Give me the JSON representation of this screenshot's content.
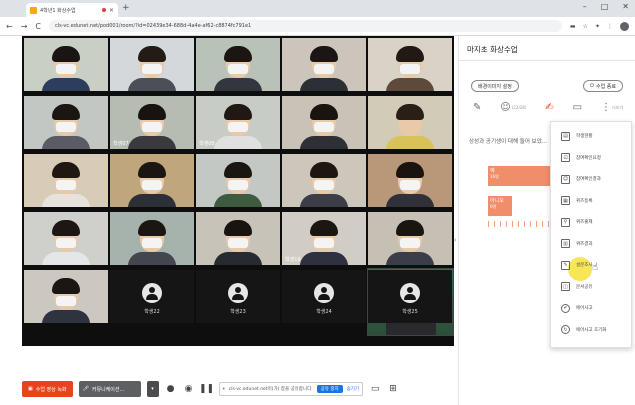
{
  "browser": {
    "tab_title": "4학년1 화상수업",
    "new_tab": "+",
    "win_min": "–",
    "win_max": "□",
    "win_close": "✕",
    "back": "←",
    "forward": "→",
    "reload": "C",
    "url": "cls-vc.edunet.net/pod001/room/?id=02439e34-688d-4a4e-af62-c8874fc791e1"
  },
  "video": {
    "tiles": [
      {
        "label": "",
        "bg": "#c9cfc4",
        "body": "#2d3e5c",
        "hair": "#1a1512",
        "mask": true
      },
      {
        "label": "",
        "bg": "#d4d8da",
        "body": "#4c4f57",
        "hair": "#221b16",
        "mask": true
      },
      {
        "label": "",
        "bg": "#b9c2b8",
        "body": "#33363c",
        "hair": "#1c1612",
        "mask": true
      },
      {
        "label": "",
        "bg": "#cbc5bb",
        "body": "#2c2f36",
        "hair": "#1b1613",
        "mask": true
      },
      {
        "label": "",
        "bg": "#d9d3c7",
        "body": "#5d4a3b",
        "hair": "#211913",
        "mask": true
      },
      {
        "label": "",
        "bg": "#c3c7c4",
        "body": "#5b5b66",
        "hair": "#1c1612",
        "mask": true
      },
      {
        "label": "학생07",
        "bg": "#b6bcb1",
        "body": "#3a3a3e",
        "hair": "#181310",
        "mask": true
      },
      {
        "label": "학생08",
        "bg": "#c8ccc6",
        "body": "#e0e0e0",
        "hair": "#1f1813",
        "mask": true
      },
      {
        "label": "",
        "bg": "#c9c2b6",
        "body": "#2e3035",
        "hair": "#1a1410",
        "mask": true
      },
      {
        "label": "",
        "bg": "#d2cbb8",
        "body": "#d8c35a",
        "hair": "#2a1f16",
        "mask": false
      },
      {
        "label": "",
        "bg": "#d8cbb8",
        "body": "#e7e2dc",
        "hair": "#1e1712",
        "mask": true
      },
      {
        "label": "",
        "bg": "#bfa67c",
        "body": "#2d2f36",
        "hair": "#1c1612",
        "mask": true
      },
      {
        "label": "",
        "bg": "#c3c8c4",
        "body": "#3e5a3f",
        "hair": "#1c1612",
        "mask": true
      },
      {
        "label": "",
        "bg": "#ccc6bb",
        "body": "#3c3d46",
        "hair": "#1d1612",
        "mask": true
      },
      {
        "label": "",
        "bg": "#b9987a",
        "body": "#2f3038",
        "hair": "#1a1410",
        "mask": true
      },
      {
        "label": "",
        "bg": "#cfd0cc",
        "body": "#e5e6e8",
        "hair": "#1d1612",
        "mask": true
      },
      {
        "label": "",
        "bg": "#a6b3ad",
        "body": "#43464f",
        "hair": "#1c1612",
        "mask": true
      },
      {
        "label": "",
        "bg": "#c8c3b9",
        "body": "#272a31",
        "hair": "#1a1410",
        "mask": true
      },
      {
        "label": "학생19",
        "bg": "#d1cdc4",
        "body": "#2d3140",
        "hair": "#1c1612",
        "mask": true
      },
      {
        "label": "",
        "bg": "#c6bfb3",
        "body": "#3b3e48",
        "hair": "#1b1511",
        "mask": true
      },
      {
        "label": "",
        "bg": "#cdc8bf",
        "body": "#2f3340",
        "hair": "#1c1612",
        "mask": true
      }
    ],
    "avatars": [
      "학생22",
      "학생23",
      "학생24",
      "학생25"
    ]
  },
  "toolbar": {
    "record_label": "수업 영상 녹화",
    "mic_label": "커뮤니케이션...",
    "mic_drop": "▾",
    "share_text": "cls-vc.edunet.net이(가) 창을 공유합니다.",
    "share_stop": "공유 중지",
    "share_hide": "숨기기"
  },
  "panel": {
    "title": "마지초 화상수업",
    "bg_button": "배경이미지 설정",
    "end_button": "수업 종료",
    "tab_more": "더보기",
    "tab_count": "(22/28)",
    "question": "상성과 공기생이 대해 들어 보았...",
    "bars": [
      {
        "label": "예",
        "value": "16명"
      },
      {
        "label": "아니오",
        "value": "6명"
      }
    ]
  },
  "menu": {
    "items": [
      "학생현황",
      "참여확인요청",
      "참여확인결과",
      "퀴즈등록",
      "퀴즈출제",
      "퀴즈결과",
      "설문조사",
      "문서공유",
      "에어사고",
      "에어사고 초기화"
    ]
  },
  "colors": {
    "accent": "#e8431f",
    "bar": "#f08d6a",
    "highlight": "#f6e23a",
    "share_blue": "#1a73e8"
  }
}
